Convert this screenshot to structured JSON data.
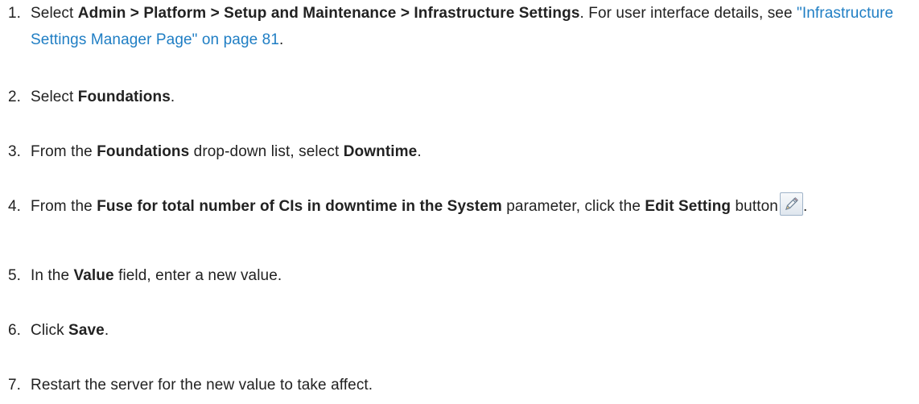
{
  "steps": [
    {
      "num": "1.",
      "pre": "Select ",
      "bold": "Admin > Platform > Setup and Maintenance > Infrastructure Settings",
      "mid": ". For user interface details, see ",
      "link": "\"Infrastructure Settings Manager Page\" on page 81",
      "post": "."
    },
    {
      "num": "2.",
      "pre": "Select ",
      "bold": "Foundations",
      "post": "."
    },
    {
      "num": "3.",
      "pre": "From the ",
      "bold": "Foundations",
      "mid": " drop-down list, select ",
      "bold2": "Downtime",
      "post": "."
    },
    {
      "num": "4.",
      "pre": "From the ",
      "bold": "Fuse for total number of CIs in downtime in the System",
      "mid": " parameter, click the ",
      "bold2": "Edit Setting",
      "mid2": " button",
      "post": ".",
      "icon": "pencil-edit-icon"
    },
    {
      "num": "5.",
      "pre": "In the ",
      "bold": "Value",
      "post": " field, enter a new value."
    },
    {
      "num": "6.",
      "pre": "Click ",
      "bold": "Save",
      "post": "."
    },
    {
      "num": "7.",
      "text": "Restart the server for the new value to take affect."
    }
  ],
  "colors": {
    "text": "#222222",
    "link": "#1f7ec4"
  }
}
